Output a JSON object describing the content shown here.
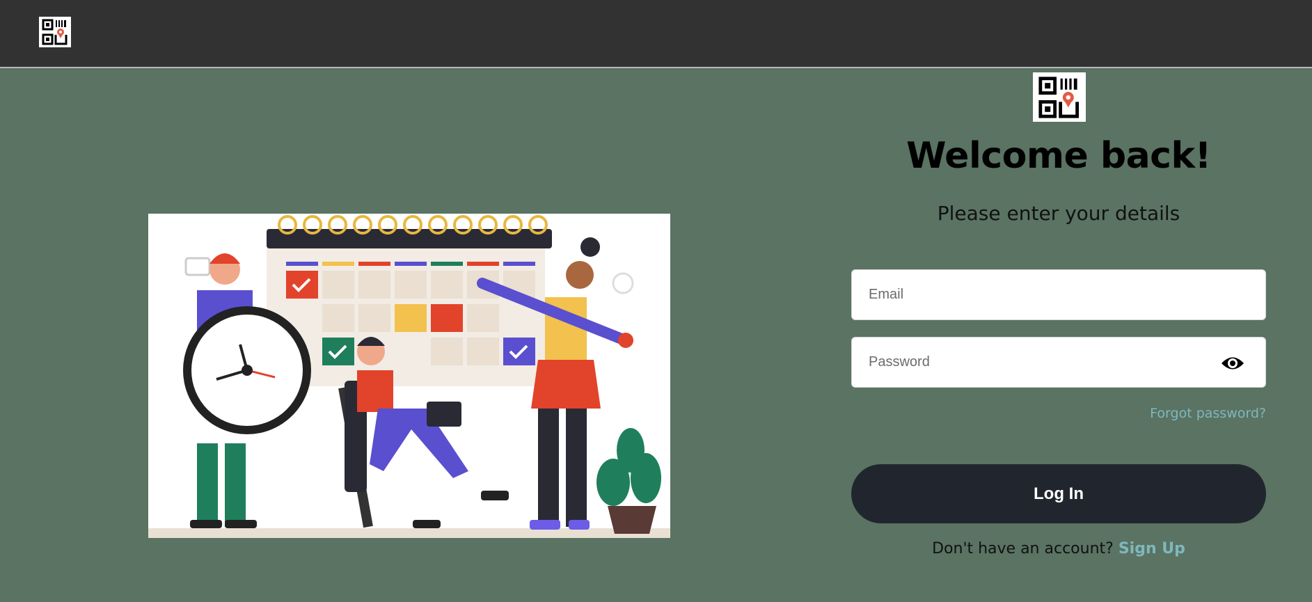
{
  "nav": {
    "logo_icon": "qr-location-icon"
  },
  "illustration": {
    "icon": "calendar-scheduling-illustration"
  },
  "form": {
    "logo_icon": "qr-location-icon",
    "title": "Welcome back!",
    "subtitle": "Please enter your details",
    "email_placeholder": "Email",
    "email_value": "",
    "password_placeholder": "Password",
    "password_value": "",
    "show_password_icon": "eye-icon",
    "forgot_label": "Forgot password?",
    "login_label": "Log In",
    "signup_prompt": "Don't have an account?",
    "signup_label": "Sign Up"
  },
  "colors": {
    "background": "#5a7363",
    "navbar": "#323232",
    "button": "#21262e",
    "link": "#7fb8bd"
  }
}
